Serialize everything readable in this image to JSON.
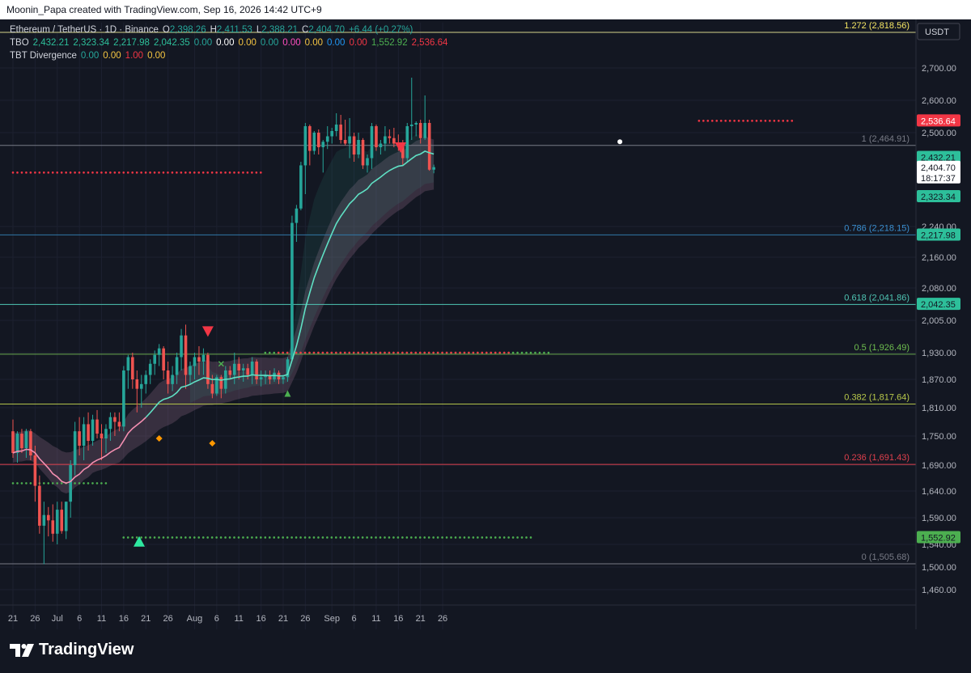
{
  "header": {
    "title": "Moonin_Papa created with TradingView.com, Sep 16, 2026 14:42 UTC+9"
  },
  "legend": {
    "line1": {
      "symbol": "Ethereum / TetherUS · 1D · Binance",
      "items": [
        {
          "label": "O",
          "value": "2,398.26"
        },
        {
          "label": "H",
          "value": "2,411.53"
        },
        {
          "label": "L",
          "value": "2,388.21"
        },
        {
          "label": "C",
          "value": "2,404.70"
        },
        {
          "label": "",
          "value": "+6.44 (+0.27%)"
        }
      ],
      "color": "#26a69a"
    },
    "line2": {
      "name": "TBO",
      "values": [
        {
          "v": "2,432.21",
          "c": "#2dbf9a"
        },
        {
          "v": "2,323.34",
          "c": "#2dbf9a"
        },
        {
          "v": "2,217.98",
          "c": "#2dbf9a"
        },
        {
          "v": "2,042.35",
          "c": "#2dbf9a"
        },
        {
          "v": "0.00",
          "c": "#26a69a"
        },
        {
          "v": "0.00",
          "c": "#ffffff"
        },
        {
          "v": "0.00",
          "c": "#f5c542"
        },
        {
          "v": "0.00",
          "c": "#26a69a"
        },
        {
          "v": "0.00",
          "c": "#ff4fbf"
        },
        {
          "v": "0.00",
          "c": "#f5c542"
        },
        {
          "v": "0.00",
          "c": "#2196f3"
        },
        {
          "v": "0.00",
          "c": "#f23645"
        },
        {
          "v": "1,552.92",
          "c": "#4caf50"
        },
        {
          "v": "2,536.64",
          "c": "#f23645"
        }
      ]
    },
    "line3": {
      "name": "TBT Divergence",
      "values": [
        {
          "v": "0.00",
          "c": "#26a69a"
        },
        {
          "v": "0.00",
          "c": "#f5c542"
        },
        {
          "v": "1.00",
          "c": "#f23645"
        },
        {
          "v": "0.00",
          "c": "#f5c542"
        }
      ]
    }
  },
  "chart_data": {
    "type": "candlestick",
    "currency": "USDT",
    "y_ticks": [
      1460,
      1500,
      1540,
      1590,
      1640,
      1690,
      1750,
      1810,
      1870,
      1930,
      2005,
      2080,
      2160,
      2240,
      2500,
      2600,
      2700
    ],
    "x_ticks": [
      {
        "day": 0,
        "label": "21"
      },
      {
        "day": 5,
        "label": "26"
      },
      {
        "day": 10,
        "label": "Jul"
      },
      {
        "day": 15,
        "label": "6"
      },
      {
        "day": 20,
        "label": "11"
      },
      {
        "day": 25,
        "label": "16"
      },
      {
        "day": 30,
        "label": "21"
      },
      {
        "day": 35,
        "label": "26"
      },
      {
        "day": 41,
        "label": "Aug"
      },
      {
        "day": 46,
        "label": "6"
      },
      {
        "day": 51,
        "label": "11"
      },
      {
        "day": 56,
        "label": "16"
      },
      {
        "day": 61,
        "label": "21"
      },
      {
        "day": 66,
        "label": "26"
      },
      {
        "day": 72,
        "label": "Sep"
      },
      {
        "day": 77,
        "label": "6"
      },
      {
        "day": 82,
        "label": "11"
      },
      {
        "day": 87,
        "label": "16"
      },
      {
        "day": 92,
        "label": "21"
      },
      {
        "day": 97,
        "label": "26"
      }
    ],
    "candles": [
      [
        1760,
        1785,
        1705,
        1715
      ],
      [
        1715,
        1760,
        1695,
        1755
      ],
      [
        1755,
        1765,
        1715,
        1725
      ],
      [
        1725,
        1765,
        1705,
        1760
      ],
      [
        1760,
        1765,
        1700,
        1710
      ],
      [
        1710,
        1730,
        1620,
        1650
      ],
      [
        1650,
        1670,
        1560,
        1575
      ],
      [
        1575,
        1620,
        1505,
        1595
      ],
      [
        1595,
        1610,
        1555,
        1585
      ],
      [
        1585,
        1615,
        1545,
        1560
      ],
      [
        1560,
        1620,
        1540,
        1605
      ],
      [
        1605,
        1620,
        1560,
        1565
      ],
      [
        1565,
        1620,
        1550,
        1620
      ],
      [
        1620,
        1700,
        1590,
        1690
      ],
      [
        1690,
        1780,
        1670,
        1760
      ],
      [
        1760,
        1790,
        1710,
        1730
      ],
      [
        1730,
        1790,
        1700,
        1775
      ],
      [
        1775,
        1800,
        1720,
        1740
      ],
      [
        1740,
        1795,
        1730,
        1785
      ],
      [
        1785,
        1805,
        1745,
        1755
      ],
      [
        1755,
        1775,
        1700,
        1745
      ],
      [
        1745,
        1775,
        1715,
        1765
      ],
      [
        1765,
        1800,
        1740,
        1790
      ],
      [
        1790,
        1800,
        1750,
        1780
      ],
      [
        1780,
        1800,
        1760,
        1770
      ],
      [
        1770,
        1900,
        1760,
        1890
      ],
      [
        1890,
        1925,
        1850,
        1920
      ],
      [
        1920,
        1930,
        1850,
        1870
      ],
      [
        1870,
        1890,
        1800,
        1850
      ],
      [
        1850,
        1880,
        1810,
        1860
      ],
      [
        1860,
        1890,
        1840,
        1880
      ],
      [
        1880,
        1915,
        1860,
        1905
      ],
      [
        1905,
        1935,
        1880,
        1925
      ],
      [
        1925,
        1950,
        1900,
        1940
      ],
      [
        1940,
        1945,
        1870,
        1890
      ],
      [
        1890,
        1910,
        1840,
        1860
      ],
      [
        1860,
        1900,
        1845,
        1880
      ],
      [
        1880,
        1930,
        1860,
        1920
      ],
      [
        1920,
        1985,
        1890,
        1970
      ],
      [
        1970,
        1995,
        1850,
        1880
      ],
      [
        1880,
        1910,
        1860,
        1900
      ],
      [
        1900,
        1930,
        1870,
        1920
      ],
      [
        1920,
        1945,
        1880,
        1910
      ],
      [
        1910,
        1940,
        1880,
        1925
      ],
      [
        1925,
        1930,
        1850,
        1860
      ],
      [
        1860,
        1880,
        1830,
        1840
      ],
      [
        1840,
        1880,
        1835,
        1875
      ],
      [
        1875,
        1880,
        1830,
        1850
      ],
      [
        1850,
        1900,
        1840,
        1890
      ],
      [
        1890,
        1900,
        1870,
        1880
      ],
      [
        1880,
        1930,
        1860,
        1905
      ],
      [
        1905,
        1920,
        1870,
        1890
      ],
      [
        1890,
        1905,
        1865,
        1895
      ],
      [
        1895,
        1905,
        1870,
        1880
      ],
      [
        1880,
        1920,
        1860,
        1910
      ],
      [
        1910,
        1915,
        1860,
        1870
      ],
      [
        1870,
        1890,
        1855,
        1875
      ],
      [
        1875,
        1890,
        1860,
        1880
      ],
      [
        1880,
        1890,
        1860,
        1870
      ],
      [
        1870,
        1895,
        1865,
        1885
      ],
      [
        1885,
        1890,
        1860,
        1870
      ],
      [
        1870,
        1880,
        1860,
        1875
      ],
      [
        1875,
        1920,
        1865,
        1915
      ],
      [
        1915,
        2270,
        1910,
        2250
      ],
      [
        2250,
        2300,
        2200,
        2290
      ],
      [
        2290,
        2420,
        2285,
        2410
      ],
      [
        2410,
        2530,
        2330,
        2520
      ],
      [
        2520,
        2525,
        2410,
        2450
      ],
      [
        2450,
        2505,
        2440,
        2500
      ],
      [
        2500,
        2510,
        2440,
        2460
      ],
      [
        2460,
        2480,
        2390,
        2475
      ],
      [
        2475,
        2520,
        2455,
        2490
      ],
      [
        2490,
        2515,
        2470,
        2505
      ],
      [
        2505,
        2560,
        2490,
        2525
      ],
      [
        2525,
        2555,
        2470,
        2480
      ],
      [
        2480,
        2540,
        2465,
        2470
      ],
      [
        2470,
        2545,
        2430,
        2490
      ],
      [
        2490,
        2500,
        2420,
        2440
      ],
      [
        2440,
        2500,
        2430,
        2480
      ],
      [
        2480,
        2485,
        2400,
        2410
      ],
      [
        2410,
        2440,
        2390,
        2430
      ],
      [
        2430,
        2530,
        2400,
        2520
      ],
      [
        2520,
        2525,
        2450,
        2460
      ],
      [
        2460,
        2480,
        2440,
        2470
      ],
      [
        2470,
        2520,
        2450,
        2490
      ],
      [
        2490,
        2510,
        2470,
        2485
      ],
      [
        2485,
        2515,
        2460,
        2470
      ],
      [
        2470,
        2495,
        2450,
        2465
      ],
      [
        2465,
        2480,
        2410,
        2430
      ],
      [
        2430,
        2530,
        2420,
        2520
      ],
      [
        2520,
        2670,
        2480,
        2525
      ],
      [
        2525,
        2535,
        2490,
        2530
      ],
      [
        2530,
        2540,
        2470,
        2485
      ],
      [
        2485,
        2615,
        2480,
        2530
      ],
      [
        2530,
        2540,
        2395,
        2398
      ],
      [
        2398,
        2412,
        2388,
        2405
      ]
    ],
    "fib_levels": [
      {
        "ratio": "1.272",
        "price": 2818.56,
        "label": "1.272 (2,818.56)",
        "color": "#d4d48a",
        "label_color": "#f5e663"
      },
      {
        "ratio": "1",
        "price": 2464.91,
        "label": "1 (2,464.91)",
        "color": "#787b86",
        "label_color": "#787b86"
      },
      {
        "ratio": "0.786",
        "price": 2218.15,
        "label": "0.786 (2,218.15)",
        "color": "#3179a8",
        "label_color": "#3a8fd0"
      },
      {
        "ratio": "0.618",
        "price": 2041.86,
        "label": "0.618 (2,041.86)",
        "color": "#4fc6b4",
        "label_color": "#4fc6b4"
      },
      {
        "ratio": "0.5",
        "price": 1926.49,
        "label": "0.5 (1,926.49)",
        "color": "#6aa84f",
        "label_color": "#6fbf4f"
      },
      {
        "ratio": "0.382",
        "price": 1817.64,
        "label": "0.382 (1,817.64)",
        "color": "#b2c24a",
        "label_color": "#b8c94a"
      },
      {
        "ratio": "0.236",
        "price": 1691.43,
        "label": "0.236 (1,691.43)",
        "color": "#e0404d",
        "label_color": "#e0404d"
      },
      {
        "ratio": "0",
        "price": 1505.68,
        "label": "0 (1,505.68)",
        "color": "#787b86",
        "label_color": "#787b86"
      }
    ],
    "price_labels": [
      {
        "text": "2,536.64",
        "price": 2536.64,
        "bg": "#f23645",
        "fg": "#ffffff"
      },
      {
        "text": "2,432.21",
        "price": 2432.21,
        "bg": "#2dbf9a",
        "fg": "#131722"
      },
      {
        "text": "2,404.70",
        "price": 2404.7,
        "bg": "#ffffff",
        "fg": "#131722",
        "sub": "18:17:37"
      },
      {
        "text": "2,323.34",
        "price": 2323.34,
        "bg": "#2dbf9a",
        "fg": "#131722"
      },
      {
        "text": "2,217.98",
        "price": 2217.98,
        "bg": "#2dbf9a",
        "fg": "#131722"
      },
      {
        "text": "2,042.35",
        "price": 2042.35,
        "bg": "#2dbf9a",
        "fg": "#131722"
      },
      {
        "text": "1,552.92",
        "price": 1552.92,
        "bg": "#4caf50",
        "fg": "#131722"
      }
    ],
    "dotted_levels": [
      {
        "price": 1655,
        "from": 0,
        "to": 21,
        "color": "#4caf50"
      },
      {
        "price": 1552.92,
        "from": 25,
        "to": 117,
        "color": "#4caf50"
      },
      {
        "price": 1930,
        "from": 57,
        "to": 121,
        "color": "#4caf50"
      },
      {
        "price": 1930,
        "from": 60,
        "to": 112,
        "color": "#f23645"
      },
      {
        "price": 2390,
        "from": 0,
        "to": 56,
        "color": "#f23645"
      },
      {
        "price": 2536.64,
        "from": 155,
        "to": 176,
        "color": "#f23645"
      }
    ],
    "markers": [
      {
        "day": 28.5,
        "price": 1545,
        "shape": "triangle-up",
        "color": "#2ee8a0"
      },
      {
        "day": 44,
        "price": 1980,
        "shape": "triangle-down",
        "color": "#f23645"
      },
      {
        "day": 87.5,
        "price": 2460,
        "shape": "triangle-down",
        "color": "#f23645"
      },
      {
        "day": 33,
        "price": 1745,
        "shape": "diamond",
        "color": "#ff9800"
      },
      {
        "day": 45,
        "price": 1735,
        "shape": "diamond",
        "color": "#ff9800"
      },
      {
        "day": 47,
        "price": 1905,
        "shape": "x",
        "color": "#4caf50"
      },
      {
        "day": 62,
        "price": 1840,
        "shape": "triangle-up-small",
        "color": "#4caf50"
      },
      {
        "day": 137,
        "price": 2475,
        "shape": "circle",
        "color": "#ffffff"
      }
    ]
  },
  "footer": {
    "brand": "TradingView"
  }
}
